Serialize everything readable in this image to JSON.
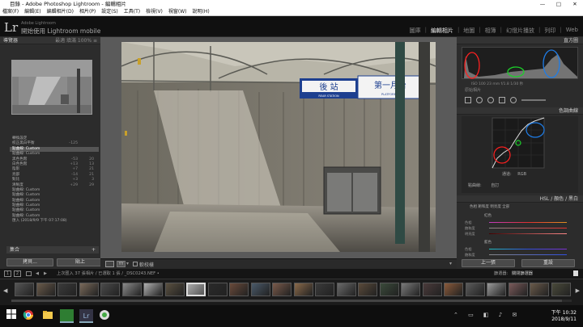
{
  "window": {
    "title": "目錄 - Adobe Photoshop Lightroom - 編輯相片",
    "controls": [
      "—",
      "□",
      "✕"
    ]
  },
  "menu": [
    "檔案(F)",
    "編輯(E)",
    "編輯相片(D)",
    "相片(P)",
    "設定(S)",
    "工具(T)",
    "檢視(V)",
    "視窗(W)",
    "說明(H)"
  ],
  "identity": {
    "logo": "Lr",
    "small": "Adobe Lightroom",
    "main": "開始使用 Lightroom mobile",
    "modules": [
      "圖庫",
      "編輯相片",
      "地圖",
      "相簿",
      "幻燈片播放",
      "列印",
      "Web"
    ],
    "active_module": "編輯相片"
  },
  "left": {
    "navigator": {
      "title": "導覽器",
      "opts": "最適  填滿  100%  ≡"
    },
    "history": [
      {
        "label": "轉換設定",
        "v1": "",
        "v2": ""
      },
      {
        "label": "校正黑白平衡",
        "v1": "–125",
        "v2": ""
      },
      {
        "label": "點曲線: Custom",
        "v1": "",
        "v2": "",
        "sel": true
      },
      {
        "label": "點曲線: Custom",
        "v1": "",
        "v2": ""
      },
      {
        "label": "黑色色階",
        "v1": "–53",
        "v2": "20"
      },
      {
        "label": "白色色階",
        "v1": "+13",
        "v2": "13"
      },
      {
        "label": "陰影",
        "v1": "+7",
        "v2": "21"
      },
      {
        "label": "亮部",
        "v1": "–14",
        "v2": "21"
      },
      {
        "label": "對比",
        "v1": "+3",
        "v2": "3"
      },
      {
        "label": "清晰度",
        "v1": "+29",
        "v2": "29"
      },
      {
        "label": "點曲線: Custom",
        "v1": "",
        "v2": ""
      },
      {
        "label": "點曲線: Custom",
        "v1": "",
        "v2": ""
      },
      {
        "label": "點曲線: Custom",
        "v1": "",
        "v2": ""
      },
      {
        "label": "點曲線: Custom",
        "v1": "",
        "v2": ""
      },
      {
        "label": "點曲線: Custom",
        "v1": "",
        "v2": ""
      },
      {
        "label": "點曲線: Custom",
        "v1": "",
        "v2": ""
      },
      {
        "label": "匯入 (2018/9/9 下午 07:17:08)",
        "v1": "",
        "v2": ""
      }
    ],
    "collections": "集合",
    "copy_btn": "拷貝...",
    "paste_btn": "貼上"
  },
  "photo": {
    "sign_left": "後 站",
    "sign_left_sub": "REAR STATION",
    "sign_right": "第一月台",
    "sign_right_sub": "PLATFORM 1"
  },
  "toolbar": {
    "proof": "軟校樣"
  },
  "right": {
    "histogram_title": "直方圖",
    "hist_info": "ISO 100  23 mm  f/1.8  1/30 秒",
    "original": "原始相片",
    "tone_curve_title": "色調曲線",
    "point_curve_label": "點曲線:",
    "point_curve_value": "自訂",
    "channel_label": "通道:",
    "channel_value": "RGB",
    "hsl_tabs": [
      "HSL",
      "/ 顏色",
      "/ 黑白"
    ],
    "hsl_sub": "色相  飽和度  明亮度  全部",
    "red_label": "紅色",
    "blue_label": "藍色",
    "sliders": [
      "色相",
      "飽和度",
      "明亮度"
    ],
    "prev_btn": "上一張",
    "reset_btn": "重設"
  },
  "filmstrip": {
    "pages": [
      "1",
      "2"
    ],
    "path": "上次匯入   37 張相片 / 已選取 1 張 / _DSC0243.NEF •",
    "filter_label": "篩選器:",
    "filter_value": "關閉篩選器"
  },
  "clock": {
    "time": "下午 10:32",
    "date": "2018/9/11"
  },
  "colors": {
    "red": "#ff2020",
    "green": "#1cd12a",
    "blue": "#1e7de8"
  }
}
